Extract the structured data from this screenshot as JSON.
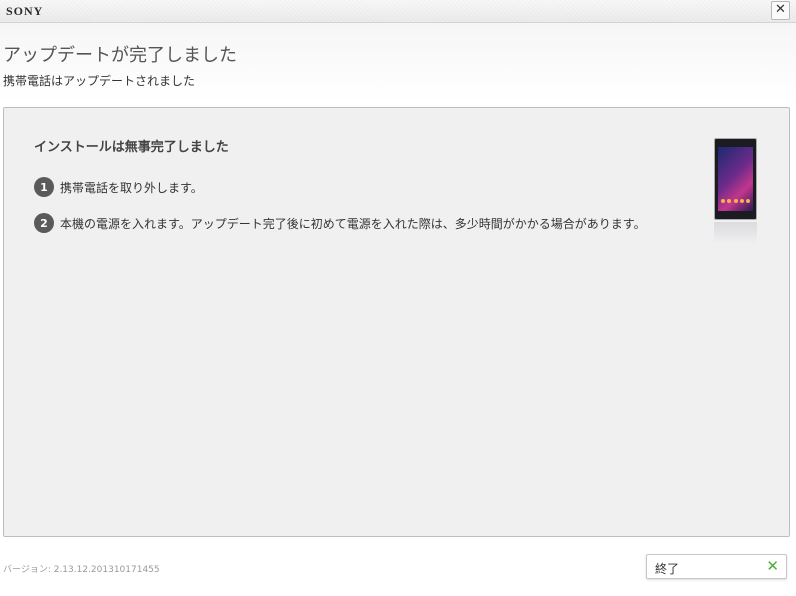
{
  "window": {
    "brand": "SONY",
    "close_icon": "close-icon"
  },
  "header": {
    "title": "アップデートが完了しました",
    "subtitle": "携帯電話はアップデートされました"
  },
  "panel": {
    "heading": "インストールは無事完了しました",
    "steps": [
      {
        "number": "1",
        "text": "携帯電話を取り外します。"
      },
      {
        "number": "2",
        "text": "本機の電源を入れます。アップデート完了後に初めて電源を入れた際は、多少時間がかかる場合があります。"
      }
    ],
    "device_image": "phone-image"
  },
  "footer": {
    "version": "バージョン: 2.13.12.201310171455",
    "finish_label": "終了",
    "finish_icon": "check-icon",
    "accent_color": "#4fae3a"
  }
}
